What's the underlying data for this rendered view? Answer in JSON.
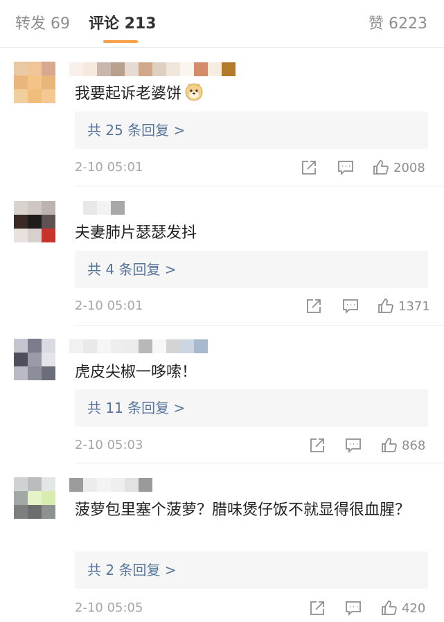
{
  "tabs": {
    "repost": "转发 69",
    "comments": "评论 213",
    "likes": "赞 6223"
  },
  "colors": {
    "accent": "#f7a14a",
    "link": "#55749c",
    "meta": "#a6a6a6"
  },
  "comments": [
    {
      "text": "我要起诉老婆饼",
      "emoji": "doge-icon",
      "replies": "共 25 条回复 >",
      "time": "2-10 05:01",
      "likes": "2008"
    },
    {
      "text": "夫妻肺片瑟瑟发抖",
      "replies": "共 4 条回复 >",
      "time": "2-10 05:01",
      "likes": "1371"
    },
    {
      "text": "虎皮尖椒一哆嗦！",
      "replies": "共 11 条回复 >",
      "time": "2-10 05:03",
      "likes": "868"
    },
    {
      "text": "菠萝包里塞个菠萝？腊味煲仔饭不就显得很血腥？",
      "replies": "共 2 条回复 >",
      "time": "2-10 05:05",
      "likes": "420"
    }
  ]
}
